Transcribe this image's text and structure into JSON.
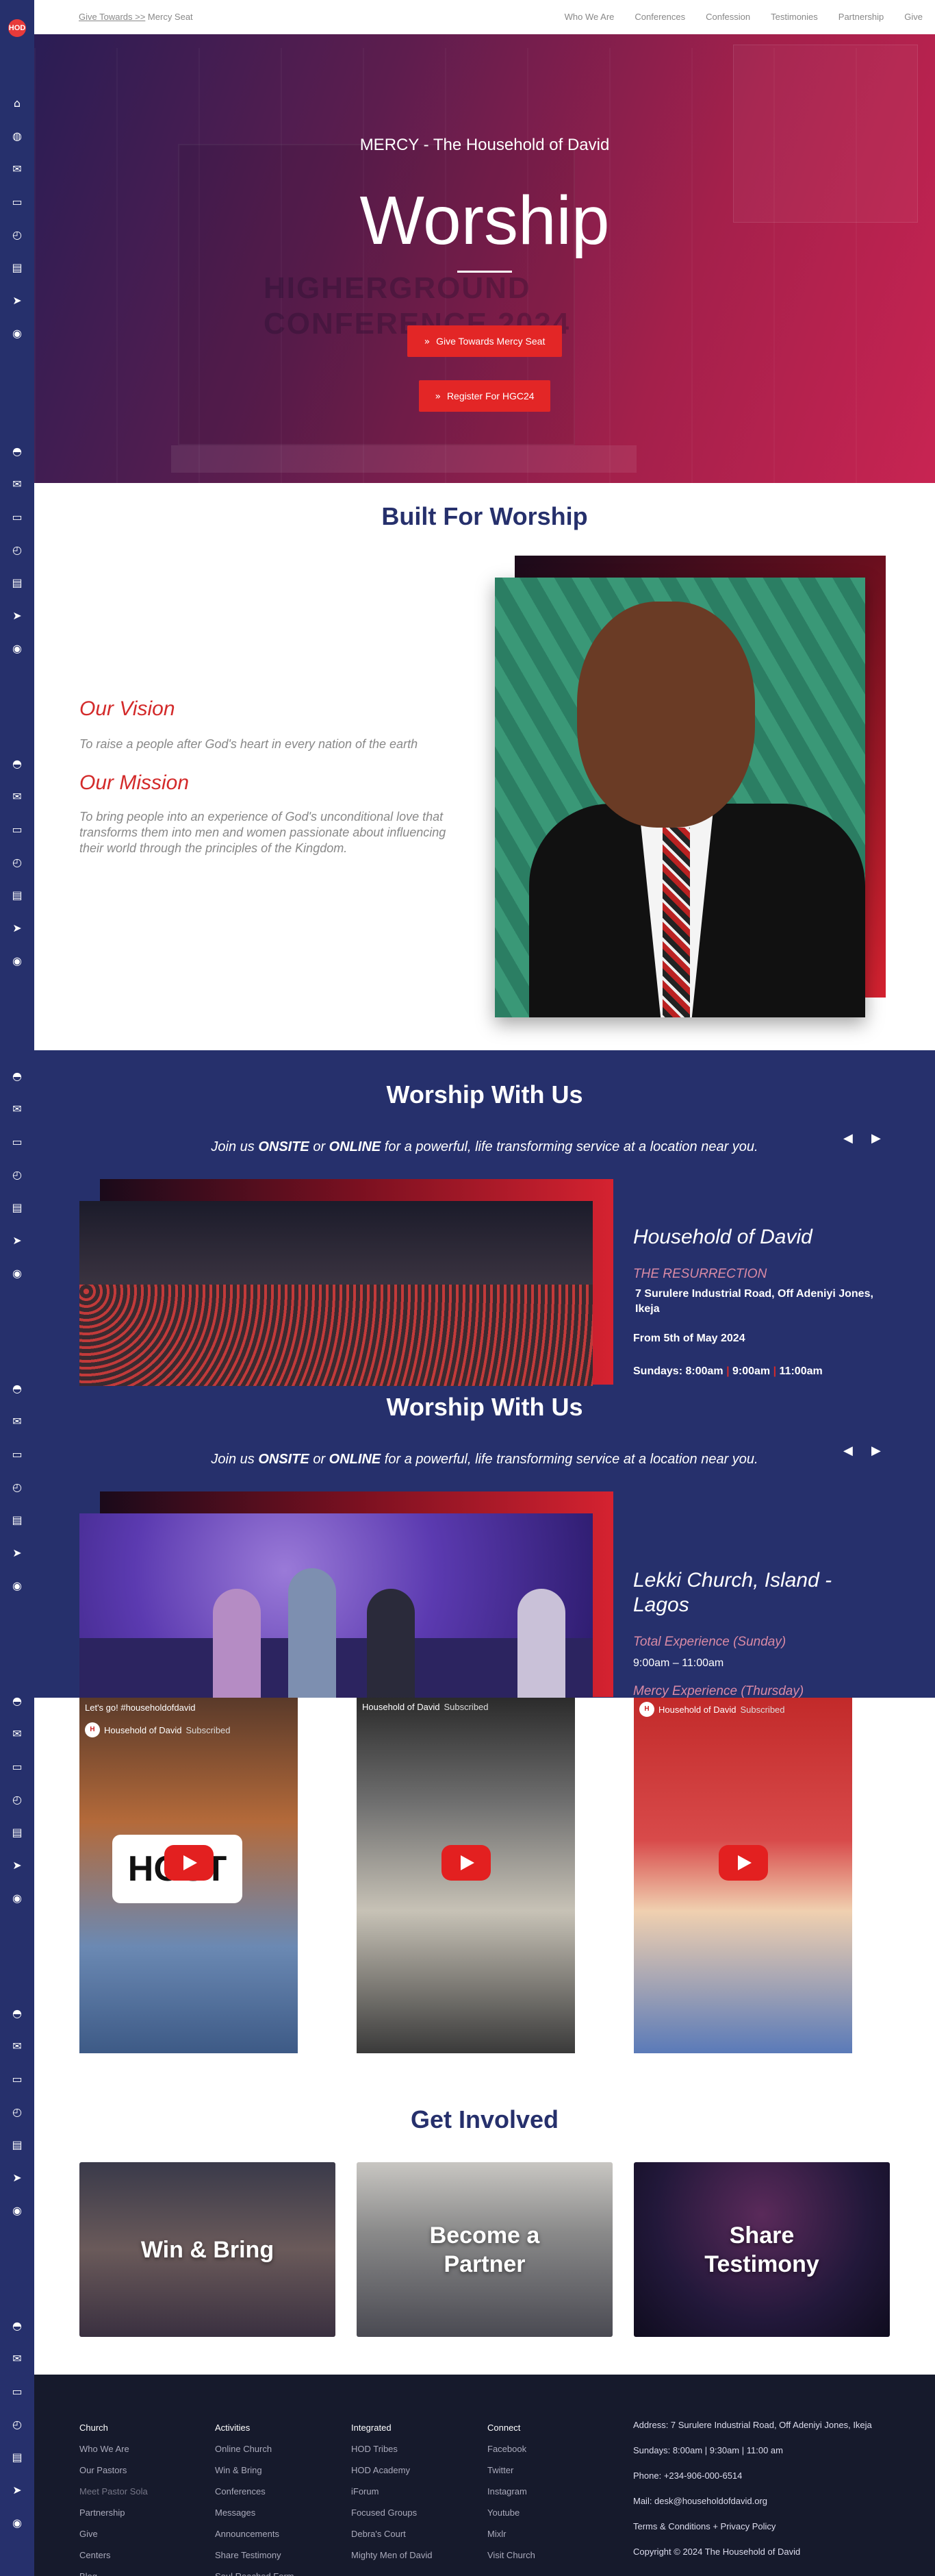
{
  "topbar": {
    "crumb_link": "Give Towards >>",
    "crumb_rest": " Mercy Seat",
    "nav": [
      "Who We Are",
      "Conferences",
      "Confession",
      "Testimonies",
      "Partnership",
      "Give"
    ]
  },
  "sidebar": {
    "logo": "HOD",
    "icons": [
      "home-icon",
      "globe-icon",
      "mail-icon",
      "video-icon",
      "history-icon",
      "book-icon",
      "compass-icon",
      "record-icon",
      "hat-icon"
    ]
  },
  "hero": {
    "subtitle": "MERCY - The Household of David",
    "title": "Worship",
    "ghost_text_1": "HIGHERGROUND",
    "ghost_text_2": "CONFERENCE 2024",
    "btn_give": "Give Towards Mercy Seat",
    "btn_register": "Register For HGC24"
  },
  "built": {
    "title": "Built For Worship",
    "vision_title": "Our Vision",
    "vision_text": "To raise a people after God's heart in every nation of the earth",
    "mission_title": "Our Mission",
    "mission_text": "To bring people into an experience of God's unconditional love that transforms them into men and women passionate about influencing their world through the principles of the Kingdom."
  },
  "worship1": {
    "title": "Worship With Us",
    "join_pre": "Join us ",
    "join_onsite": "ONSITE",
    "join_or": " or ",
    "join_online": "ONLINE",
    "join_post": " for a powerful, life transforming service at a location near you.",
    "church": "Household of David",
    "venue": "THE RESURRECTION",
    "address_1": "7 Surulere Industrial Road, Off Adeniyi Jones,",
    "address_2": "Ikeja",
    "from": "From 5th of May 2024",
    "times_label": "Sundays: 8:00am",
    "time_2": "9:00am",
    "time_3": "11:00am"
  },
  "worship2": {
    "title": "Worship With Us",
    "church_1": "Lekki Church, Island -",
    "church_2": "Lagos",
    "exp": "Total Experience (Sunday)",
    "exp_time": "9:00am – 11:00am",
    "exp2": "Mercy Experience (Thursday)"
  },
  "videos": [
    {
      "caption": "Let's go! #householdofdavid",
      "channel": "Household of David",
      "subscribed": "Subscribed",
      "overlay": "HOST"
    },
    {
      "caption": "",
      "channel": "Household of David",
      "subscribed": "Subscribed",
      "overlay": ""
    },
    {
      "caption": "",
      "channel": "Household of David",
      "subscribed": "Subscribed",
      "overlay": ""
    }
  ],
  "involved": {
    "title": "Get Involved",
    "cards": [
      {
        "line1": "Win & Bring",
        "line2": ""
      },
      {
        "line1": "Become a",
        "line2": "Partner"
      },
      {
        "line1": "Share",
        "line2": "Testimony"
      }
    ]
  },
  "footer": {
    "col1": [
      "Church",
      "Who We Are",
      "Our Pastors",
      "Meet Pastor Sola",
      "Partnership",
      "Give",
      "Centers",
      "Blog"
    ],
    "col2": [
      "Activities",
      "Online Church",
      "Win & Bring",
      "Conferences",
      "Messages",
      "Announcements",
      "Share Testimony",
      "Soul Reached Form"
    ],
    "col3": [
      "Integrated",
      "HOD Tribes",
      "HOD Academy",
      "iForum",
      "Focused Groups",
      "Debra's Court",
      "Mighty Men of David"
    ],
    "col4": [
      "Connect",
      "Facebook",
      "Twitter",
      "Instagram",
      "Youtube",
      "Mixlr",
      "Visit Church"
    ],
    "address": "Address:  7 Surulere Industrial Road, Off Adeniyi Jones, Ikeja",
    "sundays": "Sundays:  8:00am | 9:30am | 11:00 am",
    "phone": "Phone:   +234-906-000-6514",
    "mail": "Mail: desk@householdofdavid.org",
    "terms": "Terms & Conditions + Privacy Policy",
    "copyright": "Copyright © 2024 The Household of David"
  },
  "colors": {
    "navy": "#26306c",
    "red": "#e32626",
    "footer": "#161a2c"
  }
}
